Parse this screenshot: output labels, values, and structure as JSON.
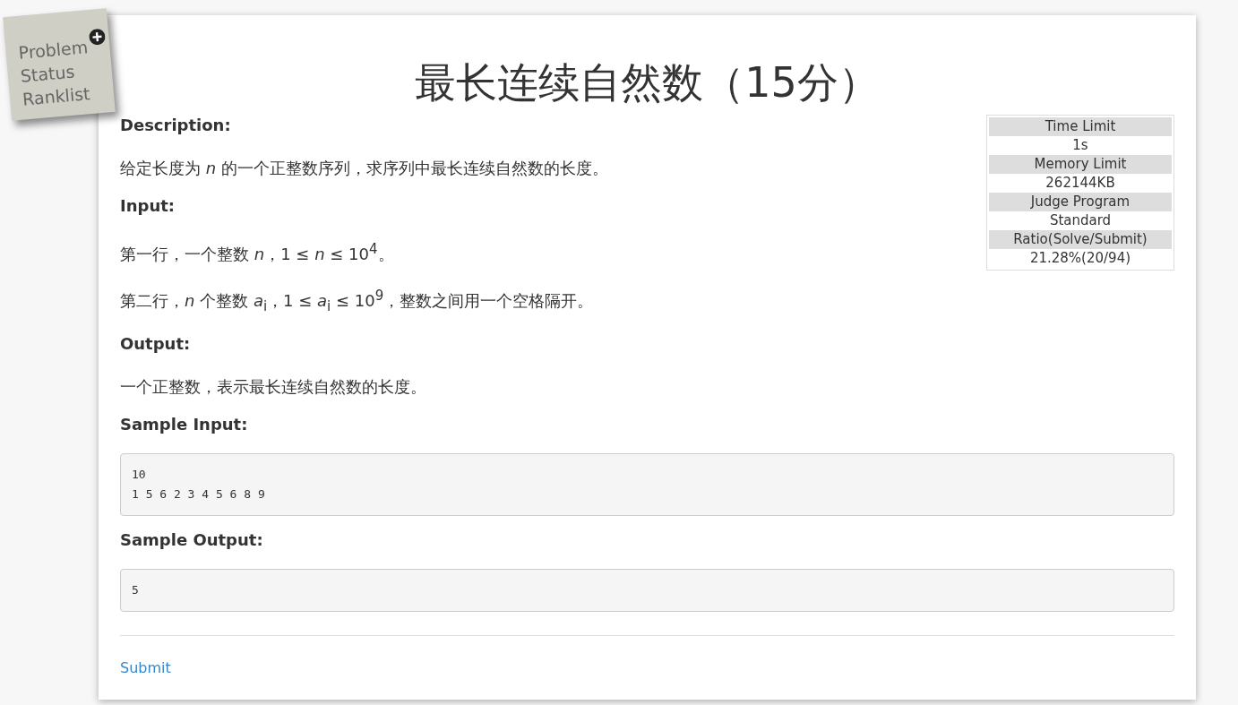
{
  "nav": {
    "items": [
      {
        "label": "Problem"
      },
      {
        "label": "Status"
      },
      {
        "label": "Ranklist"
      }
    ]
  },
  "title": "最长连续自然数（15分）",
  "info": [
    {
      "label": "Time Limit",
      "value": "1s"
    },
    {
      "label": "Memory Limit",
      "value": "262144KB"
    },
    {
      "label": "Judge Program",
      "value": "Standard"
    },
    {
      "label": "Ratio(Solve/Submit)",
      "value": "21.28%(20/94)"
    }
  ],
  "sections": [
    {
      "kind": "text",
      "heading": "Description:",
      "paragraphs": [
        "给定长度为 *n* 的一个正整数序列，求序列中最长连续自然数的长度。"
      ]
    },
    {
      "kind": "text",
      "heading": "Input:",
      "paragraphs": [
        "第一行，一个整数 *n*，1 ≤ *n* ≤ 10$^{4}$。",
        "第二行，*n* 个整数 *a*$_{i}$，1 ≤ *a*$_{i}$ ≤ 10$^{9}$，整数之间用一个空格隔开。"
      ]
    },
    {
      "kind": "text",
      "heading": "Output:",
      "paragraphs": [
        "一个正整数，表示最长连续自然数的长度。"
      ]
    },
    {
      "kind": "code",
      "heading": "Sample Input:",
      "lines": [
        "10",
        "1 5 6 2 3 4 5 6 8 9"
      ]
    },
    {
      "kind": "code",
      "heading": "Sample Output:",
      "lines": [
        "5"
      ]
    }
  ],
  "submit": "Submit"
}
